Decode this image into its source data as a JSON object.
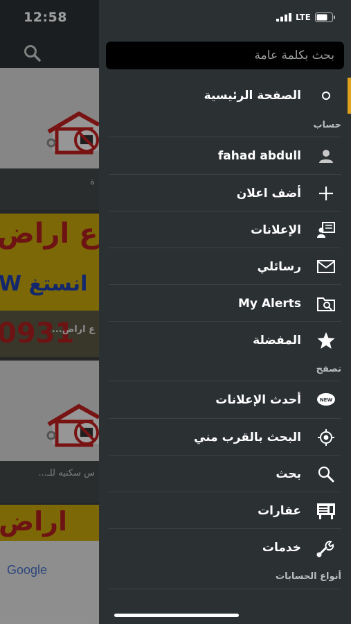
{
  "status": {
    "time": "12:58",
    "network": "LTE"
  },
  "search": {
    "placeholder": "بحث بكلمة عامة"
  },
  "menu": {
    "home": {
      "label": "الصفحة الرئيسية",
      "icon": "circle-icon"
    },
    "account_header": "حساب",
    "account": [
      {
        "label": "fahad abdull",
        "icon": "user-icon"
      },
      {
        "label": "أضف اعلان",
        "icon": "plus-icon"
      },
      {
        "label": "الإعلانات",
        "icon": "ads-icon"
      },
      {
        "label": "رسائلي",
        "icon": "envelope-icon"
      },
      {
        "label": "My Alerts",
        "icon": "alerts-icon"
      },
      {
        "label": "المفضلة",
        "icon": "star-icon"
      }
    ],
    "browse_header": "تصفح",
    "browse": [
      {
        "label": "أحدث الإعلانات",
        "icon": "new-badge-icon",
        "badge": "NEW"
      },
      {
        "label": "البحث بالقرب مني",
        "icon": "location-target-icon"
      },
      {
        "label": "بحث",
        "icon": "search-icon"
      },
      {
        "label": "عقارات",
        "icon": "real-estate-icon"
      },
      {
        "label": "خدمات",
        "icon": "wrench-icon"
      }
    ],
    "account_types_header": "أنواع الحسابات"
  },
  "background": {
    "listing_captions": [
      "ة",
      "ع اراض...",
      "س سكنيه للـ..."
    ],
    "banner_line1": "ع اراض",
    "banner_line2": "W انستغ",
    "banner_phone": "0931",
    "banner2_text": "اراض",
    "ad_brand": "Google"
  },
  "colors": {
    "drawer_bg": "#2b3033",
    "accent": "#e0a21a",
    "search_bg": "#000000"
  }
}
